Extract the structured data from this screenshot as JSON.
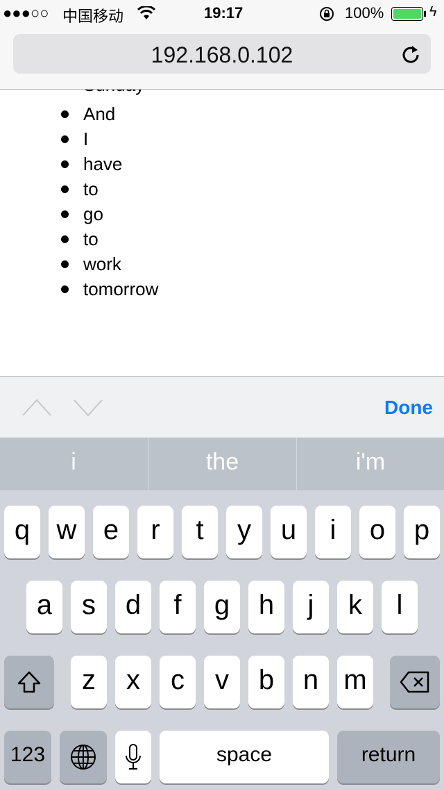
{
  "status_bar": {
    "signal": "●●●○○",
    "carrier": "中国移动",
    "time": "19:17",
    "battery": "100%",
    "battery_color": "#4cd964"
  },
  "address_bar": {
    "url": "192.168.0.102",
    "reload_icon": "reload-icon"
  },
  "list_items": [
    "Sunday",
    "And",
    "I",
    "have",
    "to",
    "go",
    "to",
    "work",
    "tomorrow"
  ],
  "accessory": {
    "prev_icon": "chevron-up-icon",
    "next_icon": "chevron-down-icon",
    "done": "Done",
    "accent": "#0a7aff"
  },
  "predictions": [
    "i",
    "the",
    "i'm"
  ],
  "keyboard": {
    "row1": [
      "q",
      "w",
      "e",
      "r",
      "t",
      "y",
      "u",
      "i",
      "o",
      "p"
    ],
    "row2": [
      "a",
      "s",
      "d",
      "f",
      "g",
      "h",
      "j",
      "k",
      "l"
    ],
    "row3": [
      "z",
      "x",
      "c",
      "v",
      "b",
      "n",
      "m"
    ],
    "numbers": "123",
    "space": "space",
    "return": "return"
  }
}
